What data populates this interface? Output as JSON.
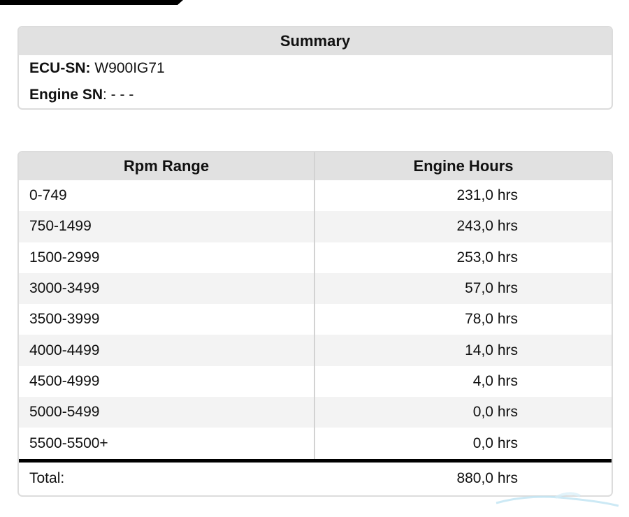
{
  "summary": {
    "title": "Summary",
    "ecu_sn_label": "ECU-SN:",
    "ecu_sn_value": " W900IG71",
    "engine_sn_label": "Engine SN",
    "engine_sn_value": ": - - -"
  },
  "rpm_table": {
    "headers": [
      "Rpm Range",
      "Engine Hours"
    ],
    "rows": [
      {
        "range": "0-749",
        "hours": "231,0 hrs"
      },
      {
        "range": "750-1499",
        "hours": "243,0 hrs"
      },
      {
        "range": "1500-2999",
        "hours": "253,0 hrs"
      },
      {
        "range": "3000-3499",
        "hours": "57,0 hrs"
      },
      {
        "range": "3500-3999",
        "hours": "78,0 hrs"
      },
      {
        "range": "4000-4499",
        "hours": "14,0 hrs"
      },
      {
        "range": "4500-4999",
        "hours": "4,0 hrs"
      },
      {
        "range": "5000-5499",
        "hours": "0,0 hrs"
      },
      {
        "range": "5500-5500+",
        "hours": "0,0 hrs"
      }
    ],
    "total_label": "Total:",
    "total_value": "880,0 hrs"
  },
  "colors": {
    "header_bg": "#e1e1e1",
    "stripe_bg": "#f3f3f3",
    "border": "#dcdcdc",
    "total_rule": "#000000"
  }
}
